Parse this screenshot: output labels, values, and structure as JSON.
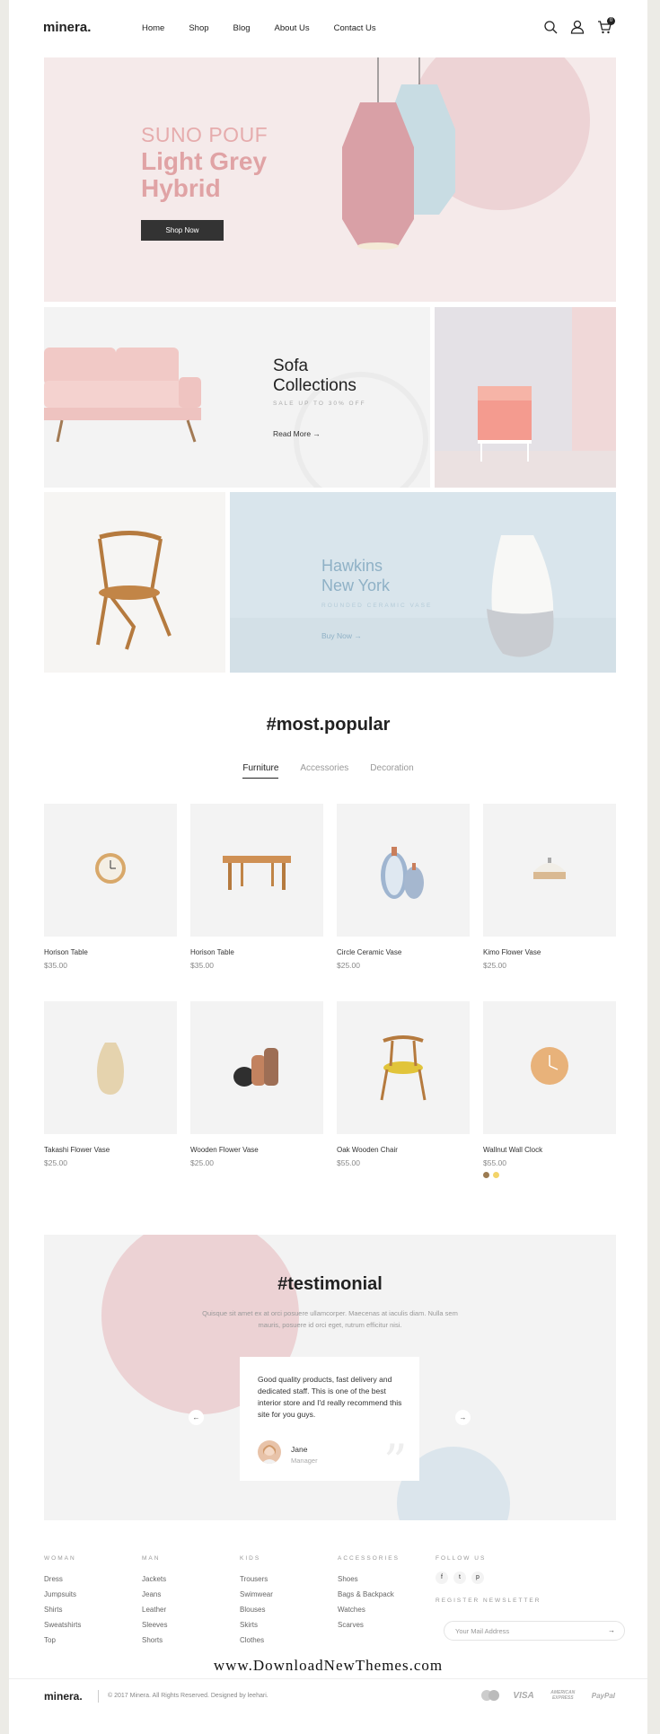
{
  "header": {
    "logo": "minera.",
    "nav": [
      "Home",
      "Shop",
      "Blog",
      "About Us",
      "Contact Us"
    ],
    "cart_count": "0"
  },
  "hero": {
    "subtitle": "SUNO POUF",
    "title_line1": "Light Grey",
    "title_line2": "Hybrid",
    "button": "Shop Now"
  },
  "banner_sofa": {
    "title_line1": "Sofa",
    "title_line2": "Collections",
    "subtitle": "SALE UP TO 30% OFF",
    "link": "Read More →"
  },
  "banner_vase": {
    "title_line1": "Hawkins",
    "title_line2": "New York",
    "subtitle": "ROUNDED CERAMIC VASE",
    "link": "Buy Now →"
  },
  "popular": {
    "title": "#most.popular",
    "tabs": [
      "Furniture",
      "Accessories",
      "Decoration"
    ],
    "products": [
      {
        "name": "Horison Table",
        "price": "$35.00",
        "icon": "desk-clock"
      },
      {
        "name": "Horison Table",
        "price": "$35.00",
        "icon": "table"
      },
      {
        "name": "Circle Ceramic Vase",
        "price": "$25.00",
        "icon": "ceramic-vases"
      },
      {
        "name": "Kimo Flower Vase",
        "price": "$25.00",
        "icon": "bowl-vase"
      },
      {
        "name": "Takashi Flower Vase",
        "price": "$25.00",
        "icon": "jug-vase"
      },
      {
        "name": "Wooden Flower Vase",
        "price": "$25.00",
        "icon": "pots"
      },
      {
        "name": "Oak Wooden Chair",
        "price": "$55.00",
        "icon": "chair"
      },
      {
        "name": "Wallnut Wall Clock",
        "price": "$55.00",
        "icon": "wall-clock"
      }
    ],
    "swatch_colors": [
      "#9b7b52",
      "#f3d46a"
    ]
  },
  "testimonial": {
    "title": "#testimonial",
    "description": "Quisque sit amet ex at orci posuere ullamcorper. Maecenas at iaculis diam. Nulla sem mauris, posuere id orci eget, rutrum efficitur nisi.",
    "quote": "Good quality products, fast delivery and dedicated staff. This is one of the best interior store and I'd really recommend this site for you guys.",
    "author": "Jane",
    "role": "Manager",
    "prev": "←",
    "next": "→"
  },
  "footer": {
    "columns": [
      {
        "heading": "WOMAN",
        "items": [
          "Dress",
          "Jumpsuits",
          "Shirts",
          "Sweatshirts",
          "Top"
        ]
      },
      {
        "heading": "MAN",
        "items": [
          "Jackets",
          "Jeans",
          "Leather",
          "Sleeves",
          "Shorts"
        ]
      },
      {
        "heading": "KIDS",
        "items": [
          "Trousers",
          "Swimwear",
          "Blouses",
          "Skirts",
          "Clothes"
        ]
      },
      {
        "heading": "ACCESSORIES",
        "items": [
          "Shoes",
          "Bags & Backpack",
          "Watches",
          "Scarves"
        ]
      }
    ],
    "follow_heading": "FOLLOW US",
    "social": [
      "f",
      "t",
      "p"
    ],
    "newsletter_heading": "REGISTER NEWSLETTER",
    "newsletter_placeholder": "Your Mail Address",
    "newsletter_go": "→",
    "watermark": "www.DownloadNewThemes.com",
    "logo": "minera.",
    "copyright": "© 2017 Minera. All Rights Reserved. Designed by leehari.",
    "payments": [
      "VISA",
      "AMERICAN EXPRESS",
      "PayPal"
    ]
  }
}
